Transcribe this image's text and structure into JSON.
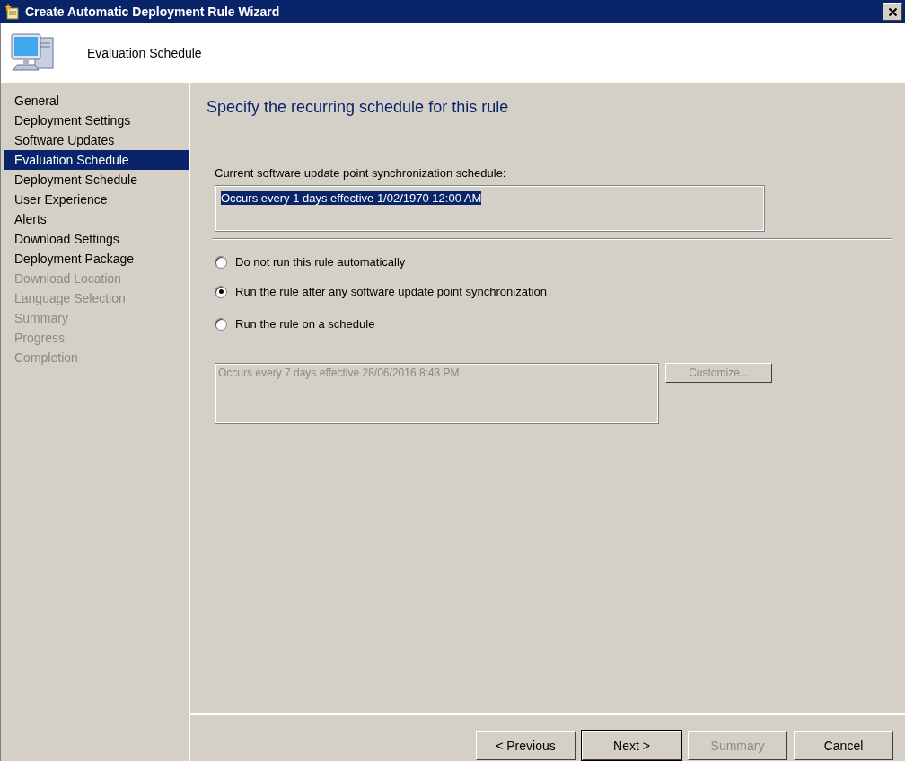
{
  "window": {
    "title": "Create Automatic Deployment Rule Wizard"
  },
  "header": {
    "title": "Evaluation Schedule"
  },
  "steps": [
    {
      "label": "General",
      "selected": false,
      "disabled": false
    },
    {
      "label": "Deployment Settings",
      "selected": false,
      "disabled": false
    },
    {
      "label": "Software Updates",
      "selected": false,
      "disabled": false
    },
    {
      "label": "Evaluation Schedule",
      "selected": true,
      "disabled": false
    },
    {
      "label": "Deployment Schedule",
      "selected": false,
      "disabled": false
    },
    {
      "label": "User Experience",
      "selected": false,
      "disabled": false
    },
    {
      "label": "Alerts",
      "selected": false,
      "disabled": false
    },
    {
      "label": "Download Settings",
      "selected": false,
      "disabled": false
    },
    {
      "label": "Deployment Package",
      "selected": false,
      "disabled": false
    },
    {
      "label": "Download Location",
      "selected": false,
      "disabled": true
    },
    {
      "label": "Language Selection",
      "selected": false,
      "disabled": true
    },
    {
      "label": "Summary",
      "selected": false,
      "disabled": true
    },
    {
      "label": "Progress",
      "selected": false,
      "disabled": true
    },
    {
      "label": "Completion",
      "selected": false,
      "disabled": true
    }
  ],
  "content": {
    "heading": "Specify the recurring schedule for this rule",
    "sync_schedule": {
      "label": "Current software update point synchronization schedule:",
      "value": "Occurs every 1 days effective 1/02/1970 12:00 AM"
    },
    "options": [
      {
        "label": "Do not run this rule automatically",
        "selected": false
      },
      {
        "label": "Run the rule after any software update point synchronization",
        "selected": true
      },
      {
        "label": "Run the rule on a schedule",
        "selected": false
      }
    ],
    "custom_schedule": {
      "value": "Occurs every 7 days effective 28/06/2016 8:43 PM",
      "disabled": true
    },
    "customize_button": {
      "label": "Customize...",
      "disabled": true
    }
  },
  "buttons": [
    {
      "label": "< Previous",
      "disabled": false,
      "default": false
    },
    {
      "label": "Next >",
      "disabled": false,
      "default": true
    },
    {
      "label": "Summary",
      "disabled": true,
      "default": false
    },
    {
      "label": "Cancel",
      "disabled": false,
      "default": false
    }
  ]
}
